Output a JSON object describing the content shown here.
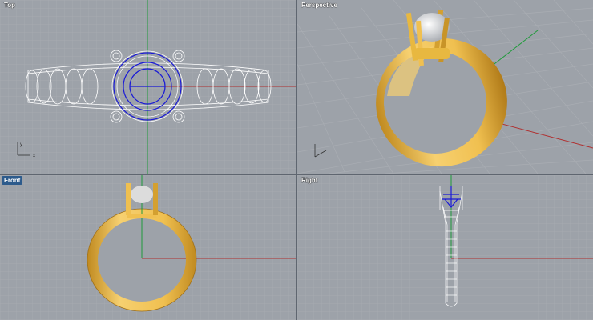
{
  "viewports": {
    "top": {
      "label": "Top",
      "axis_x": "x",
      "axis_y": "y"
    },
    "perspective": {
      "label": "Perspective"
    },
    "front": {
      "label": "Front",
      "active": true
    },
    "right": {
      "label": "Right"
    }
  },
  "colors": {
    "background": "#9da2a9",
    "grid_minor": "#a9adb3",
    "grid_major": "#8d9299",
    "axis_x": "#b03030",
    "axis_y": "#1f9a3a",
    "wireframe": "#ffffff",
    "selection": "#1a1ad6",
    "gold": "#f0c050",
    "gold_dark": "#c08a20",
    "active_label_bg": "#2d5b8c"
  }
}
